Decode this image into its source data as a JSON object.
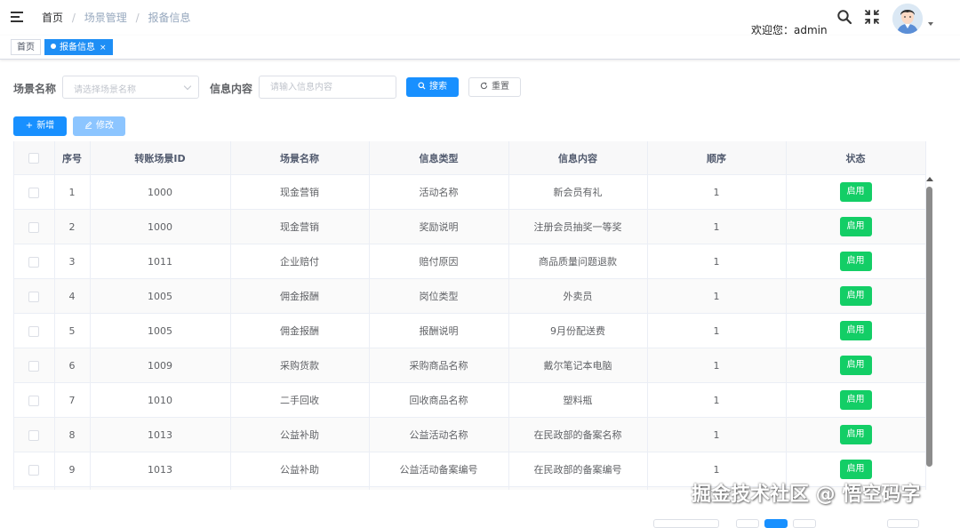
{
  "navbar": {
    "breadcrumb": [
      "首页",
      "场景管理",
      "报备信息"
    ],
    "breadcrumb_sep": "/",
    "user_greeting": "欢迎您：admin"
  },
  "tags": [
    {
      "label": "首页",
      "active": false
    },
    {
      "label": "报备信息",
      "active": true,
      "close": "×"
    }
  ],
  "filter": {
    "scene_name_label": "场景名称",
    "scene_name_placeholder": "请选择场景名称",
    "info_content_label": "信息内容",
    "info_content_placeholder": "请输入信息内容",
    "search_label": "搜索",
    "reset_label": "重置"
  },
  "toolbar": {
    "add_label": "新增",
    "edit_label": "修改"
  },
  "table": {
    "columns": [
      "序号",
      "转账场景ID",
      "场景名称",
      "信息类型",
      "信息内容",
      "顺序",
      "状态"
    ],
    "rows": [
      {
        "index": "1",
        "scene_id": "1000",
        "scene_name": "现金营销",
        "info_type": "活动名称",
        "info_content": "新会员有礼",
        "order": "1",
        "status": "启用"
      },
      {
        "index": "2",
        "scene_id": "1000",
        "scene_name": "现金营销",
        "info_type": "奖励说明",
        "info_content": "注册会员抽奖一等奖",
        "order": "1",
        "status": "启用"
      },
      {
        "index": "3",
        "scene_id": "1011",
        "scene_name": "企业赔付",
        "info_type": "赔付原因",
        "info_content": "商品质量问题退款",
        "order": "1",
        "status": "启用"
      },
      {
        "index": "4",
        "scene_id": "1005",
        "scene_name": "佣金报酬",
        "info_type": "岗位类型",
        "info_content": "外卖员",
        "order": "1",
        "status": "启用"
      },
      {
        "index": "5",
        "scene_id": "1005",
        "scene_name": "佣金报酬",
        "info_type": "报酬说明",
        "info_content": "9月份配送费",
        "order": "1",
        "status": "启用"
      },
      {
        "index": "6",
        "scene_id": "1009",
        "scene_name": "采购货款",
        "info_type": "采购商品名称",
        "info_content": "戴尔笔记本电脑",
        "order": "1",
        "status": "启用"
      },
      {
        "index": "7",
        "scene_id": "1010",
        "scene_name": "二手回收",
        "info_type": "回收商品名称",
        "info_content": "塑料瓶",
        "order": "1",
        "status": "启用"
      },
      {
        "index": "8",
        "scene_id": "1013",
        "scene_name": "公益补助",
        "info_type": "公益活动名称",
        "info_content": "在民政部的备案名称",
        "order": "1",
        "status": "启用"
      },
      {
        "index": "9",
        "scene_id": "1013",
        "scene_name": "公益补助",
        "info_type": "公益活动备案编号",
        "info_content": "在民政部的备案编号",
        "order": "1",
        "status": "启用"
      }
    ]
  },
  "watermark": "掘金技术社区 @ 悟空码字",
  "colors": {
    "primary": "#1890ff",
    "success": "#13ce66",
    "active_tag": "#1e8ef5"
  }
}
